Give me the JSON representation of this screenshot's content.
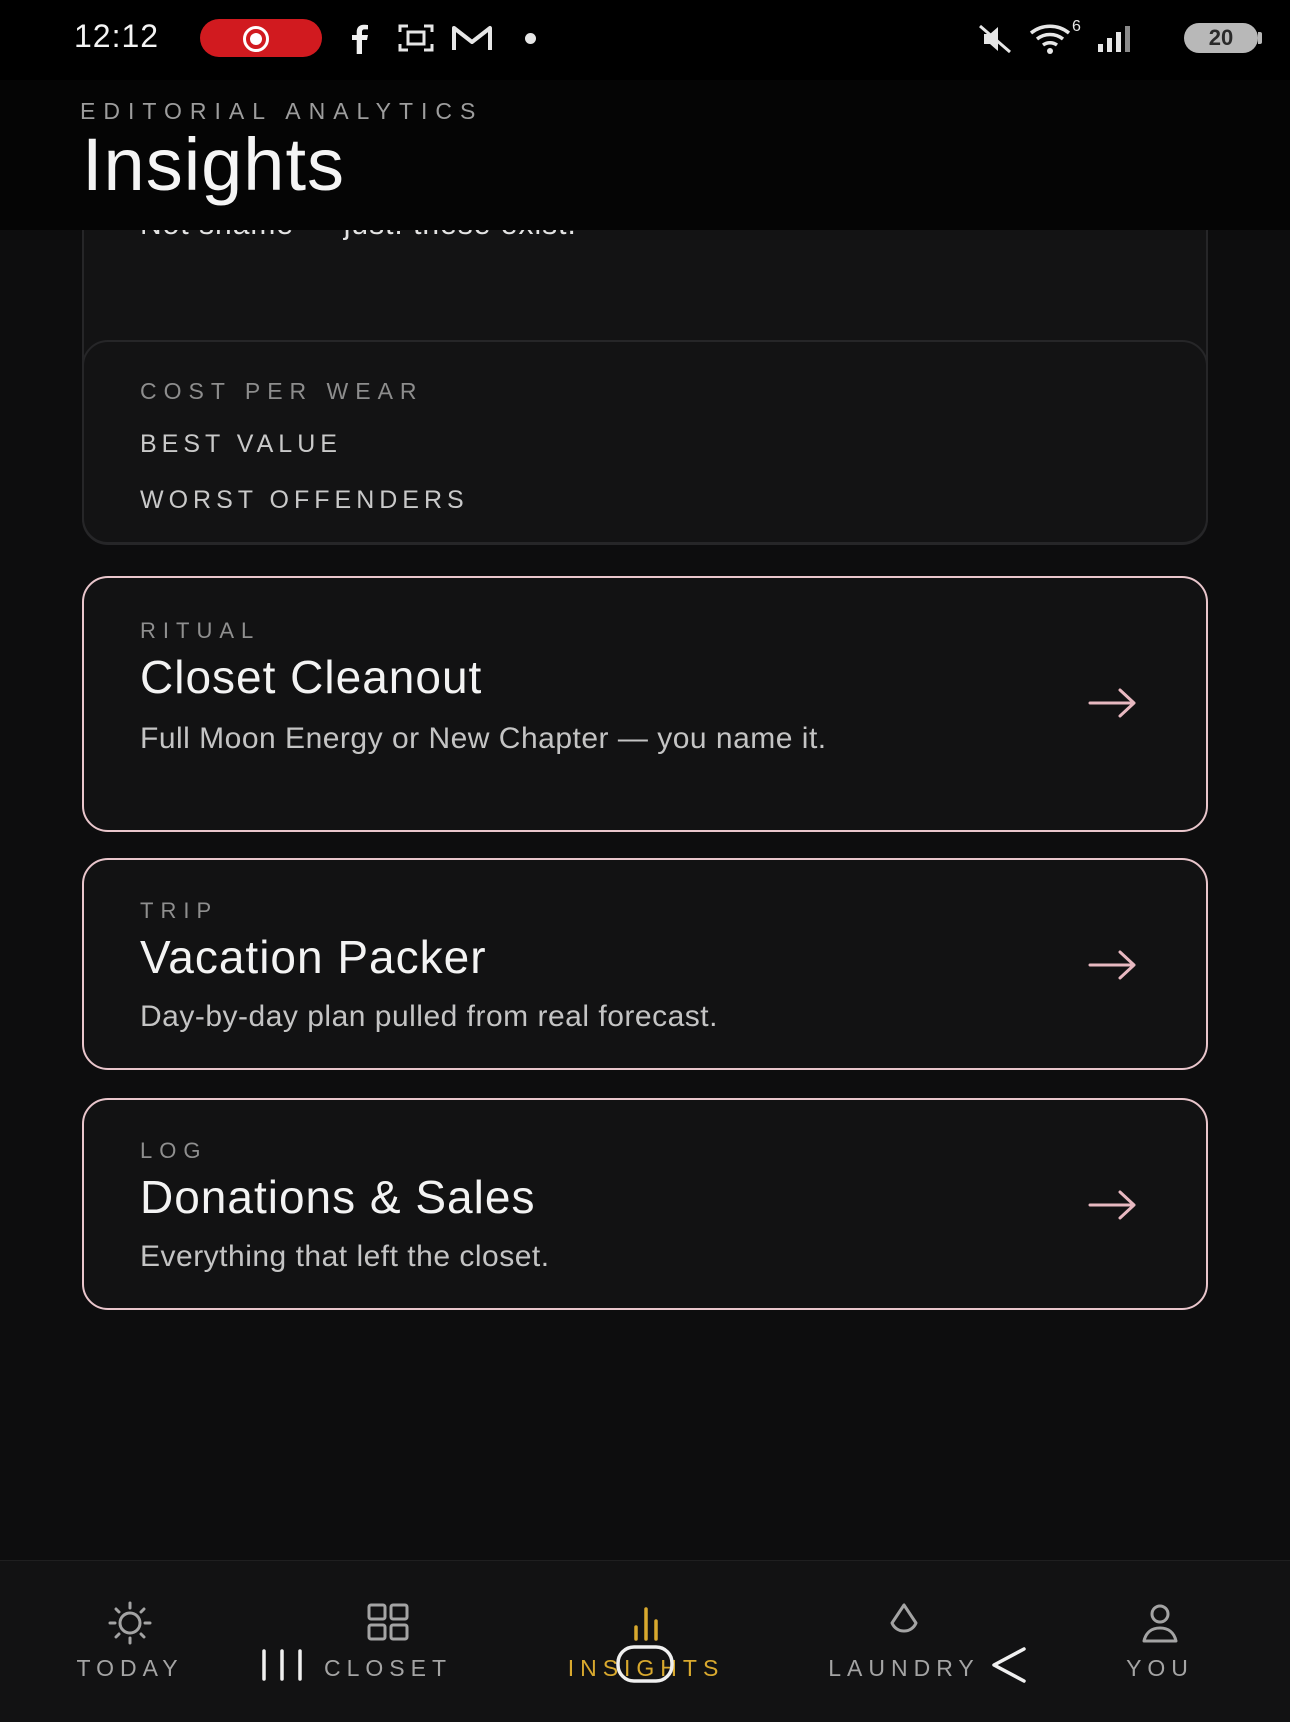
{
  "status_bar": {
    "time": "12:12",
    "battery": "20",
    "icons": [
      "record-icon",
      "facebook-icon",
      "screenshot-icon",
      "gmail-icon",
      "notification-dot",
      "mute-icon",
      "wifi-icon",
      "signal-icon",
      "battery-icon"
    ],
    "wifi_badge": "6"
  },
  "header": {
    "eyebrow": "EDITORIAL ANALYTICS",
    "title": "Insights"
  },
  "clipped_card": {
    "text": "Not shame — just: these exist."
  },
  "cost_per_wear": {
    "heading": "COST PER WEAR",
    "best_value": "BEST VALUE",
    "worst_offenders": "WORST OFFENDERS"
  },
  "link_cards": [
    {
      "kicker": "RITUAL",
      "title": "Closet Cleanout",
      "description": "Full Moon Energy or New Chapter — you name it."
    },
    {
      "kicker": "TRIP",
      "title": "Vacation Packer",
      "description": "Day-by-day plan pulled from real forecast."
    },
    {
      "kicker": "LOG",
      "title": "Donations & Sales",
      "description": "Everything that left the closet."
    }
  ],
  "bottom_nav": {
    "active": "INSIGHTS",
    "accent_color": "#d9a92e",
    "items": [
      {
        "label": "TODAY",
        "icon": "sun-icon"
      },
      {
        "label": "CLOSET",
        "icon": "grid-icon"
      },
      {
        "label": "INSIGHTS",
        "icon": "bar-chart-icon"
      },
      {
        "label": "LAUNDRY",
        "icon": "drop-icon"
      },
      {
        "label": "YOU",
        "icon": "person-icon"
      }
    ]
  },
  "colors": {
    "background": "#0d0d0e",
    "card_accent_border": "#e9c6cc",
    "arrow": "#e8b9c1"
  }
}
